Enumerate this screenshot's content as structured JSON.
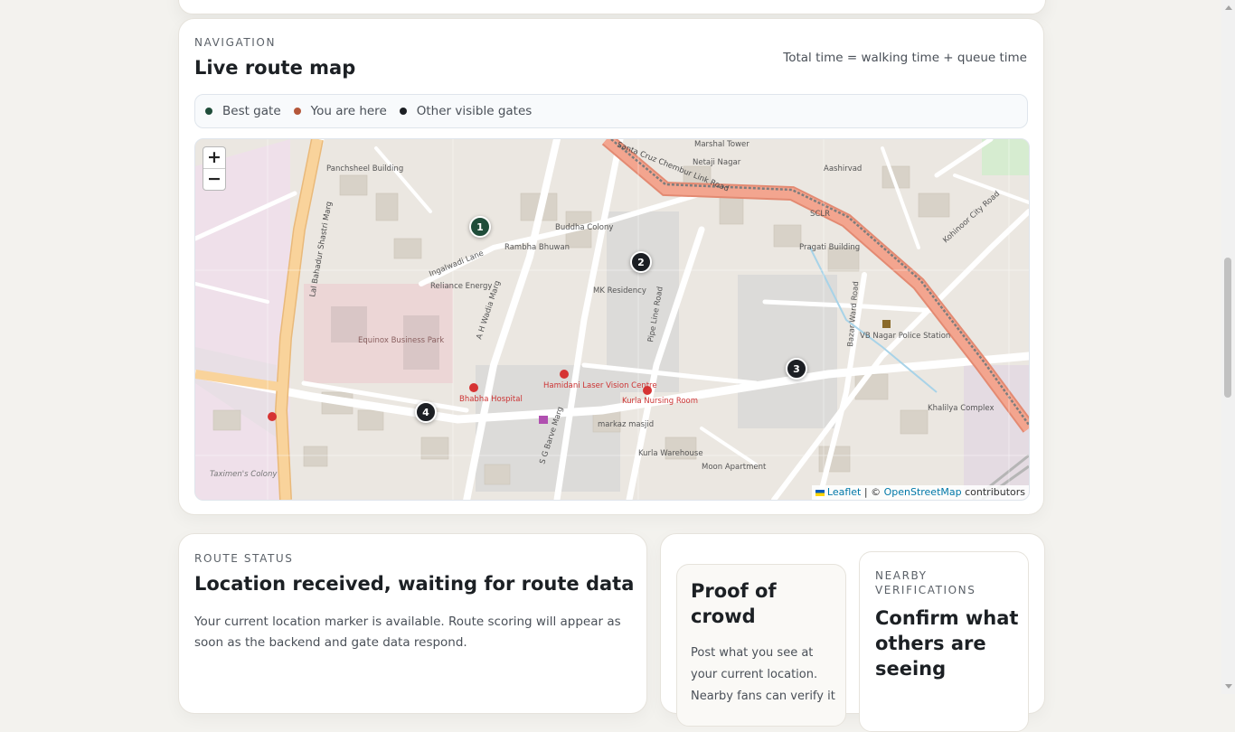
{
  "navigation": {
    "eyebrow": "NAVIGATION",
    "title": "Live route map",
    "note": "Total time = walking time + queue time",
    "legend": [
      {
        "label": "Best gate",
        "color": "#1f4d3a"
      },
      {
        "label": "You are here",
        "color": "#b5573a"
      },
      {
        "label": "Other visible gates",
        "color": "#1c1f24"
      }
    ],
    "map": {
      "zoom_in": "+",
      "zoom_out": "−",
      "gates": [
        {
          "label": "1",
          "type": "best"
        },
        {
          "label": "2",
          "type": "other"
        },
        {
          "label": "3",
          "type": "other"
        },
        {
          "label": "4",
          "type": "other"
        }
      ],
      "attribution": {
        "leaflet": "Leaflet",
        "separator": " | © ",
        "osm": "OpenStreetMap",
        "suffix": " contributors"
      },
      "labels": {
        "road1": "Santa Cruz Chembur Link Road",
        "road2": "Lal Bahadur Shastri Marg",
        "road3": "A H Wadia Marg",
        "road4": "Ingalwadi Lane",
        "road5": "Pipe Line Road",
        "road6": "Bazar Ward Road",
        "road7": "S G Barve Marg",
        "road8": "Kohinoor City Road",
        "place1": "Equinox Business Park",
        "place2": "Bhabha Hospital",
        "place3": "Kurla Nursing Room",
        "place4": "Hamidani Laser Vision Centre",
        "place5": "VB Nagar Police Station",
        "place6": "Buddha Colony",
        "place7": "MK Residency",
        "place8": "Khalilya Complex",
        "place9": "Panchsheel Building",
        "place10": "Reliance Energy",
        "place11": "Taximen's Colony",
        "place12": "Pragati Building",
        "place13": "SCLR",
        "place14": "markaz masjid",
        "place15": "Rambha Bhuwan",
        "place16": "Kurla Warehouse",
        "place17": "Moon Apartment",
        "place18": "Netaji Nagar",
        "place19": "Aashirvad",
        "place20": "Marshal Tower"
      }
    }
  },
  "route_status": {
    "eyebrow": "ROUTE STATUS",
    "title": "Location received, waiting for route data",
    "body": "Your current location marker is available. Route scoring will appear as soon as the backend and gate data respond."
  },
  "proof": {
    "title": "Proof of crowd",
    "body": "Post what you see at your current location. Nearby fans can verify it"
  },
  "nearby": {
    "eyebrow": "NEARBY VERIFICATIONS",
    "title": "Confirm what others are seeing"
  }
}
